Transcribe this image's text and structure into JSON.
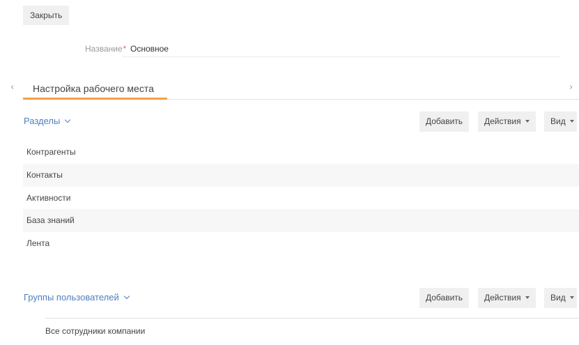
{
  "toolbar": {
    "close_label": "Закрыть"
  },
  "form": {
    "name_label": "Название",
    "required_mark": "*",
    "name_value": "Основное"
  },
  "tabs": {
    "prev_arrow": "‹",
    "next_arrow": "›",
    "items": [
      {
        "label": "Настройка рабочего места",
        "active": true
      }
    ]
  },
  "sections_panel": {
    "title": "Разделы",
    "add_label": "Добавить",
    "actions_label": "Действия",
    "view_label": "Вид",
    "items": [
      {
        "label": "Контрагенты"
      },
      {
        "label": "Контакты"
      },
      {
        "label": "Активности"
      },
      {
        "label": "База знаний"
      },
      {
        "label": "Лента"
      }
    ]
  },
  "groups_panel": {
    "title": "Группы пользователей",
    "add_label": "Добавить",
    "actions_label": "Действия",
    "view_label": "Вид",
    "items": [
      {
        "label": "Все сотрудники компании"
      }
    ]
  },
  "colors": {
    "accent_link": "#4c7fc0",
    "tab_active_underline": "#f5a047",
    "required_mark": "#e86a5a",
    "button_bg": "#f0f0f0",
    "alt_row_bg": "#f7f7f7"
  },
  "icons": {
    "section_toggle": "chevron-down-icon",
    "dropdown": "caret-down-icon",
    "tab_prev": "chevron-left-icon",
    "tab_next": "chevron-right-icon"
  }
}
